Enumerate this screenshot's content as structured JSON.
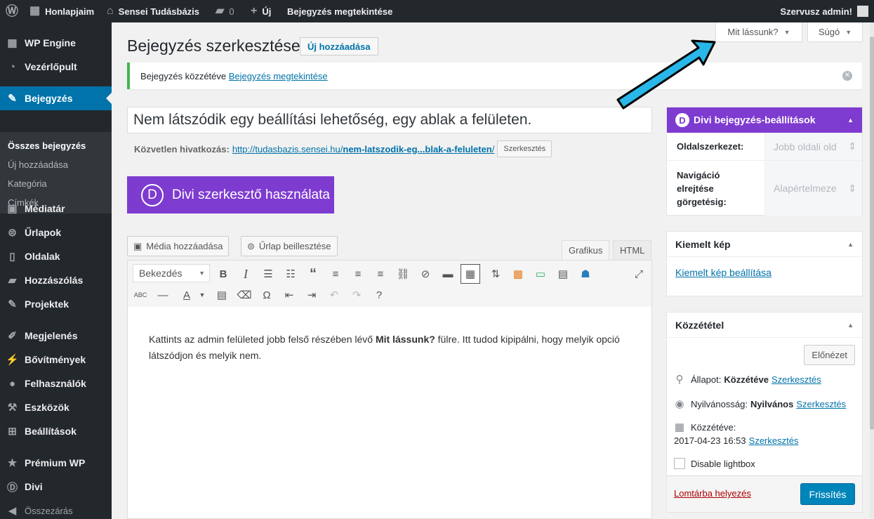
{
  "admin_bar": {
    "my_sites": "Honlapjaim",
    "site_name": "Sensei Tudásbázis",
    "comments_count": "0",
    "new_label": "Új",
    "view_post": "Bejegyzés megtekintése",
    "greeting": "Szervusz admin!"
  },
  "sidebar": {
    "items": [
      {
        "label": "WP Engine",
        "icon": "grid-icon"
      },
      {
        "label": "Vezérlőpult",
        "icon": "dashboard-icon"
      },
      {
        "label": "Bejegyzés",
        "icon": "pin-icon"
      },
      {
        "label": "Médiatár",
        "icon": "media-icon"
      },
      {
        "label": "Űrlapok",
        "icon": "forms-icon"
      },
      {
        "label": "Oldalak",
        "icon": "page-icon"
      },
      {
        "label": "Hozzászólás",
        "icon": "comment-icon"
      },
      {
        "label": "Projektek",
        "icon": "pin-icon"
      },
      {
        "label": "Megjelenés",
        "icon": "brush-icon"
      },
      {
        "label": "Bővítmények",
        "icon": "plugin-icon"
      },
      {
        "label": "Felhasználók",
        "icon": "user-icon"
      },
      {
        "label": "Eszközök",
        "icon": "wrench-icon"
      },
      {
        "label": "Beállítások",
        "icon": "settings-icon"
      },
      {
        "label": "Prémium WP",
        "icon": "star-icon"
      },
      {
        "label": "Divi",
        "icon": "divi-icon"
      }
    ],
    "submenu": [
      "Összes bejegyzés",
      "Új hozzáadása",
      "Kategória",
      "Címkék"
    ],
    "collapse": "Összezárás"
  },
  "screen_options": {
    "label": "Mit lássunk?",
    "help": "Súgó"
  },
  "page": {
    "title": "Bejegyzés szerkesztése",
    "add_new": "Új hozzáadása",
    "notice_text": "Bejegyzés közzétéve",
    "notice_link": "Bejegyzés megtekintése",
    "post_title": "Nem látszódik egy beállítási lehetőség, egy ablak a felületen.",
    "permalink_label": "Közvetlen hivatkozás:",
    "permalink_base": "http://tudasbazis.sensei.hu/",
    "permalink_slug": "nem-latszodik-eg...blak-a-feluleten",
    "permalink_end": "/",
    "permalink_edit": "Szerkesztés",
    "divi_builder": "Divi szerkesztő használata"
  },
  "editor": {
    "add_media": "Média hozzáadása",
    "add_form": "Űrlap beillesztése",
    "tab_visual": "Grafikus",
    "tab_html": "HTML",
    "format": "Bekezdés",
    "content_before": "Kattints az admin felületed jobb felső részében lévő ",
    "content_bold": "Mit lássunk?",
    "content_after": " fülre. Itt tudod kipipálni, hogy melyik opció látszódjon és melyik nem."
  },
  "divi_box": {
    "title": "Divi bejegyzés-beállítások",
    "layout_label": "Oldalszerkezet:",
    "layout_value": "Jobb oldali old",
    "nav_label": "Navigáció elrejtése görgetésig:",
    "nav_value": "Alapértelmeze"
  },
  "featured_box": {
    "title": "Kiemelt kép",
    "link": "Kiemelt kép beállítása"
  },
  "publish_box": {
    "title": "Közzététel",
    "preview": "Előnézet",
    "status_label": "Állapot:",
    "status_value": "Közzétéve",
    "visibility_label": "Nyilvánosság:",
    "visibility_value": "Nyilvános",
    "published_label": "Közzétéve:",
    "published_date": "2017-04-23 16:53",
    "edit": "Szerkesztés",
    "lightbox": "Disable lightbox",
    "trash": "Lomtárba helyezés",
    "update": "Frissítés"
  },
  "colors": {
    "accent": "#0073aa",
    "divi": "#7e3bd0",
    "arrow": "#29b6e8"
  }
}
